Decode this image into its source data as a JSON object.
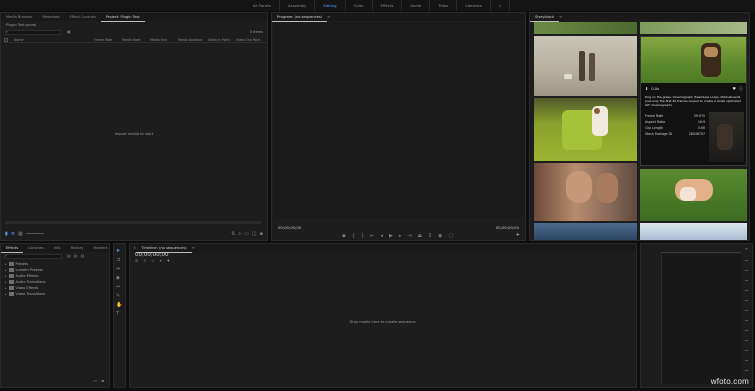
{
  "workspaces": [
    "All Panels",
    "Assembly",
    "Editing",
    "Color",
    "Effects",
    "Audio",
    "Titles",
    "Libraries"
  ],
  "active_workspace": "Editing",
  "project_panel": {
    "tabs": [
      "Media Browser",
      "Metadata",
      "Effect Controls",
      "Project: Plugin Test"
    ],
    "project_file": "Plugin Test.prproj",
    "items_count": "0 Items",
    "columns": [
      "Name",
      "Frame Rate",
      "Media Start",
      "Media End",
      "Media Duration",
      "Video In Point",
      "Video Out Point"
    ],
    "empty_message": "Import media to start"
  },
  "program_monitor": {
    "title": "Program: (no sequences)",
    "timecode_left": "00;00;00;00",
    "timecode_right": "00;00;00;00"
  },
  "storyblock": {
    "title": "Storyblock",
    "selected_price": "0.0x",
    "description": "Dog on the grass. Cinemagraph (Seamless Loop). Noticeboards (use only the first 40 frames looped to create a small optimized GIF cinemagraph)",
    "info": [
      {
        "label": "Frame Rate",
        "value": "29.970"
      },
      {
        "label": "Aspect Ratio",
        "value": "16:9"
      },
      {
        "label": "Clip Length",
        "value": "0:06"
      },
      {
        "label": "Stock Footage ID",
        "value": "28046797"
      }
    ]
  },
  "effects_panel": {
    "tabs": [
      "Effects",
      "Libraries",
      "Info",
      "History",
      "Markers"
    ],
    "folders": [
      "Presets",
      "Lumetri Presets",
      "Audio Effects",
      "Audio Transitions",
      "Video Effects",
      "Video Transitions"
    ]
  },
  "timeline": {
    "title": "Timeline: (no sequences)",
    "timecode": "00;00;00;00",
    "empty_message": "Drop media here to create sequence."
  },
  "watermark": "wfoto.com",
  "colors": {
    "accent": "#5aa0ff",
    "panel_bg": "#1d1d1d",
    "app_bg": "#0e0e0e"
  }
}
